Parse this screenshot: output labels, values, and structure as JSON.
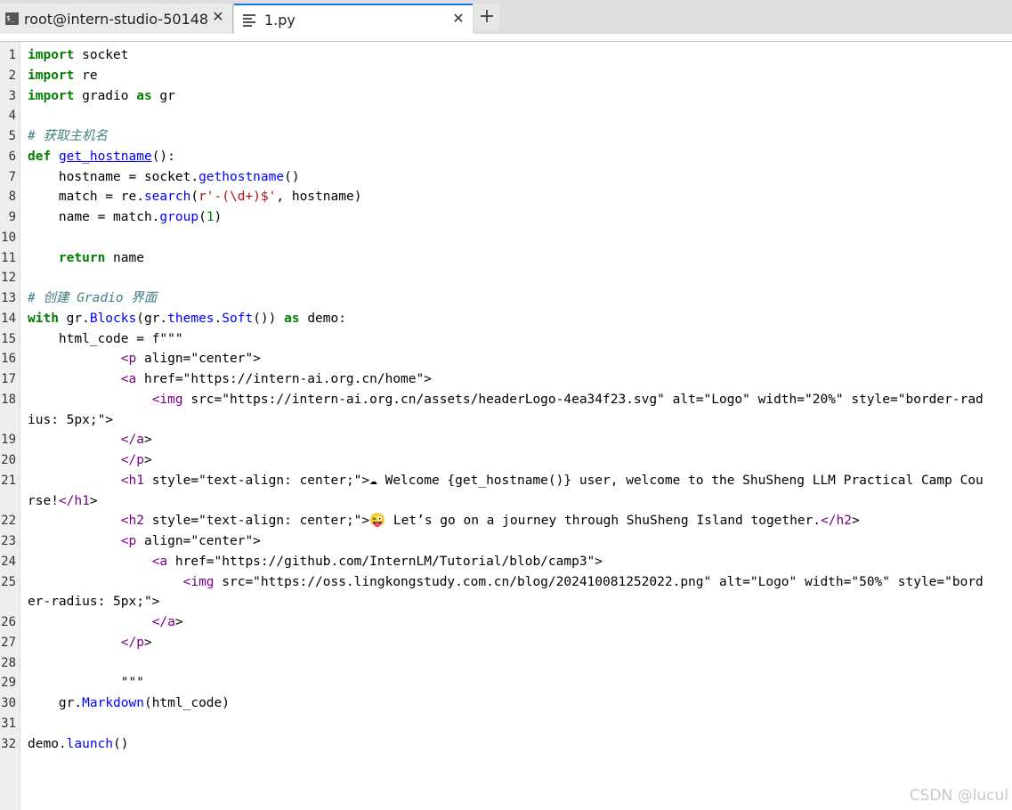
{
  "tabs": [
    {
      "label": "root@intern-studio-50148",
      "icon": "terminal-icon"
    },
    {
      "label": "1.py",
      "icon": "file-text-icon"
    }
  ],
  "add_tab": "+",
  "close_glyph": "✕",
  "watermark": "CSDN @lucul",
  "code_lines": [
    {
      "n": "1",
      "src": "import socket"
    },
    {
      "n": "2",
      "src": "import re"
    },
    {
      "n": "3",
      "src": "import gradio as gr"
    },
    {
      "n": "4",
      "src": ""
    },
    {
      "n": "5",
      "src": "# 获取主机名"
    },
    {
      "n": "6",
      "src": "def get_hostname():"
    },
    {
      "n": "7",
      "src": "    hostname = socket.gethostname()"
    },
    {
      "n": "8",
      "src": "    match = re.search(r'-(\\d+)$', hostname)"
    },
    {
      "n": "9",
      "src": "    name = match.group(1)"
    },
    {
      "n": "10",
      "src": ""
    },
    {
      "n": "11",
      "src": "    return name"
    },
    {
      "n": "12",
      "src": ""
    },
    {
      "n": "13",
      "src": "# 创建 Gradio 界面"
    },
    {
      "n": "14",
      "src": "with gr.Blocks(gr.themes.Soft()) as demo:"
    },
    {
      "n": "15",
      "src": "    html_code = f\"\"\""
    },
    {
      "n": "16",
      "src": "            <p align=\"center\">"
    },
    {
      "n": "17",
      "src": "            <a href=\"https://intern-ai.org.cn/home\">"
    },
    {
      "n": "18",
      "src": "                <img src=\"https://intern-ai.org.cn/assets/headerLogo-4ea34f23.svg\" alt=\"Logo\" width=\"20%\" style=\"border-radius: 5px;\">"
    },
    {
      "n": "19",
      "src": "            </a>"
    },
    {
      "n": "20",
      "src": "            </p>"
    },
    {
      "n": "21",
      "src": "            <h1 style=\"text-align: center;\">☁ Welcome {get_hostname()} user, welcome to the ShuSheng LLM Practical Camp Course!</h1>"
    },
    {
      "n": "22",
      "src": "            <h2 style=\"text-align: center;\">😜 Let’s go on a journey through ShuSheng Island together.</h2>"
    },
    {
      "n": "23",
      "src": "            <p align=\"center\">"
    },
    {
      "n": "24",
      "src": "                <a href=\"https://github.com/InternLM/Tutorial/blob/camp3\">"
    },
    {
      "n": "25",
      "src": "                    <img src=\"https://oss.lingkongstudy.com.cn/blog/202410081252022.png\" alt=\"Logo\" width=\"50%\" style=\"border-radius: 5px;\">"
    },
    {
      "n": "26",
      "src": "                </a>"
    },
    {
      "n": "27",
      "src": "            </p>"
    },
    {
      "n": "28",
      "src": ""
    },
    {
      "n": "29",
      "src": "            \"\"\""
    },
    {
      "n": "30",
      "src": "    gr.Markdown(html_code)"
    },
    {
      "n": "31",
      "src": ""
    },
    {
      "n": "32",
      "src": "demo.launch()"
    }
  ]
}
